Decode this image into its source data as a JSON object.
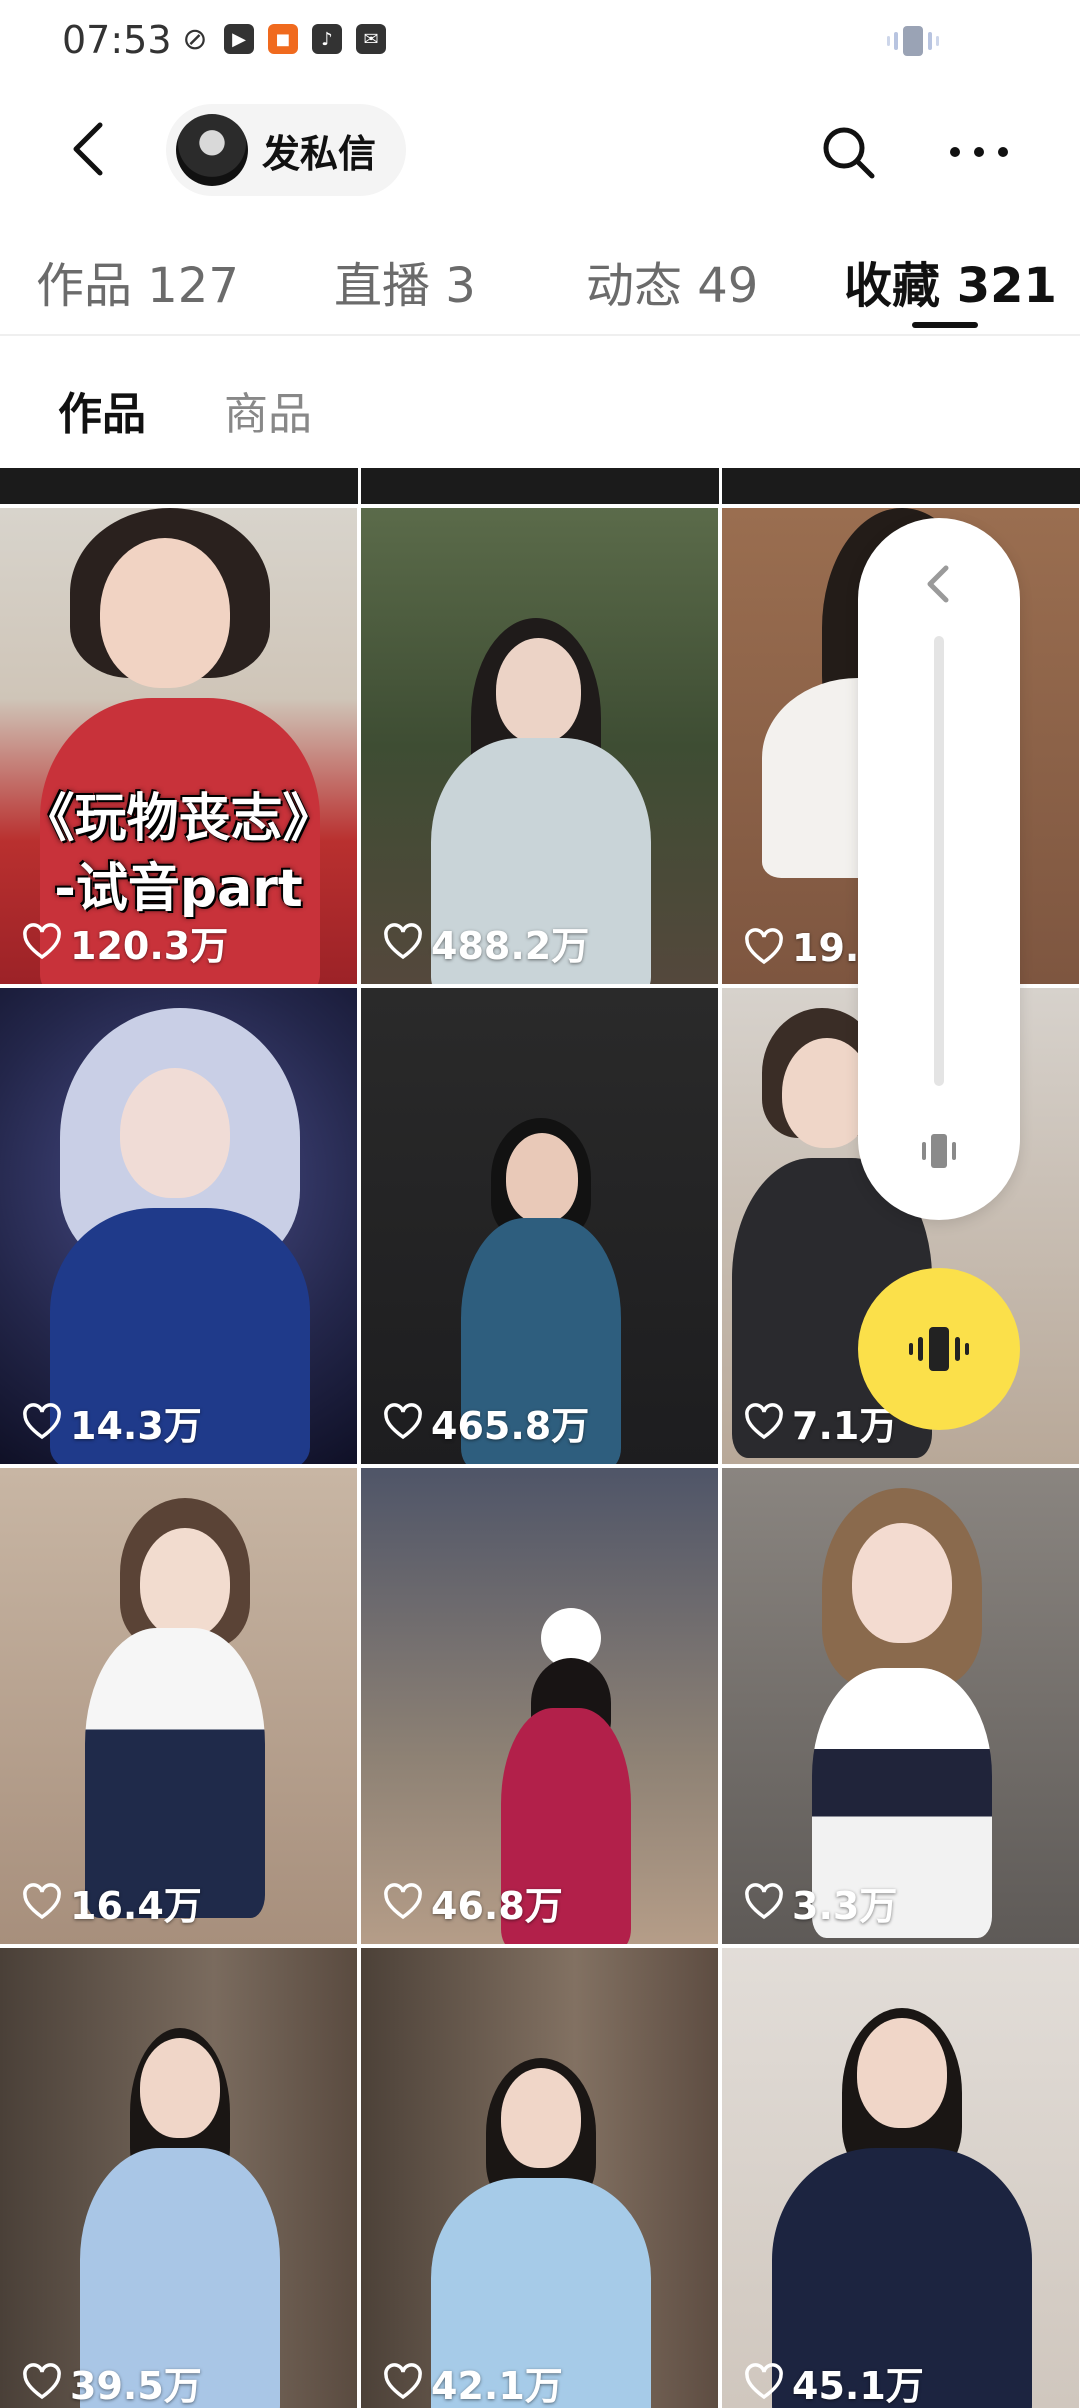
{
  "status_bar": {
    "time": "07:53"
  },
  "header": {
    "dm_label": "发私信"
  },
  "tabs": [
    {
      "label": "作品 127",
      "active": false
    },
    {
      "label": "直播 3",
      "active": false
    },
    {
      "label": "动态 49",
      "active": false
    },
    {
      "label": "收藏 321",
      "active": true
    }
  ],
  "subtabs": [
    {
      "label": "作品",
      "active": true
    },
    {
      "label": "商品",
      "active": false
    }
  ],
  "grid": {
    "items": [
      {
        "likes": "120.3万",
        "title_line1": "《玩物丧志》",
        "title_line2": "-试音part"
      },
      {
        "likes": "488.2万"
      },
      {
        "likes": "19."
      },
      {
        "likes": "14.3万"
      },
      {
        "likes": "465.8万"
      },
      {
        "likes": "7.1万"
      },
      {
        "likes": "16.4万"
      },
      {
        "likes": "46.8万"
      },
      {
        "likes": "3.3万"
      },
      {
        "likes": "39.5万"
      },
      {
        "likes": "42.1万"
      },
      {
        "likes": "45.1万"
      }
    ]
  },
  "colors": {
    "accent_yellow": "#fbe04a",
    "active_tab": "#111111",
    "inactive_tab": "#6b6b6b"
  }
}
